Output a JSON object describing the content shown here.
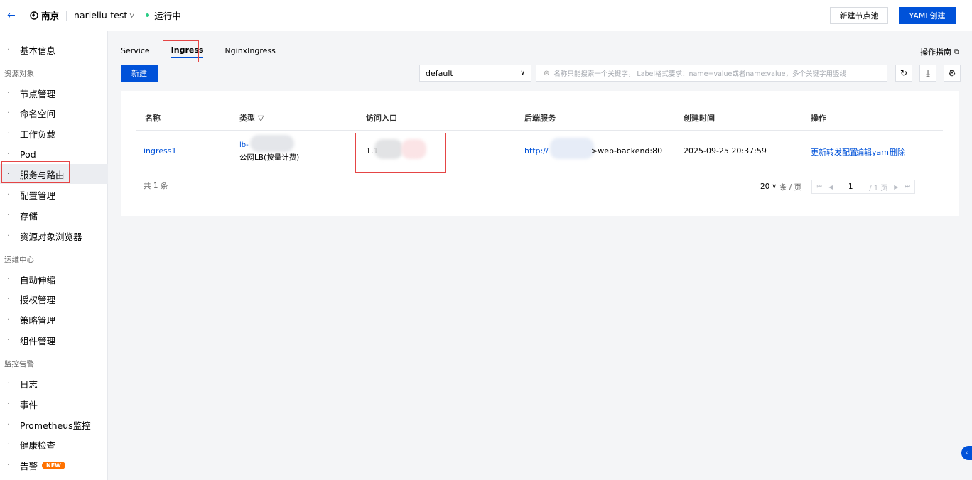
{
  "topbar": {
    "region": "南京",
    "cluster": "narieliu-test",
    "status": "运行中",
    "new_pool_button": "新建节点池",
    "yaml_button": "YAML创建"
  },
  "sidebar": {
    "items": [
      {
        "label": "基本信息"
      },
      {
        "group": "资源对象"
      },
      {
        "label": "节点管理"
      },
      {
        "label": "命名空间"
      },
      {
        "label": "工作负载"
      },
      {
        "label": "Pod"
      },
      {
        "label": "服务与路由"
      },
      {
        "label": "配置管理"
      },
      {
        "label": "存储"
      },
      {
        "label": "资源对象浏览器"
      },
      {
        "group": "运维中心"
      },
      {
        "label": "自动伸缩"
      },
      {
        "label": "授权管理"
      },
      {
        "label": "策略管理"
      },
      {
        "label": "组件管理"
      },
      {
        "group": "监控告警"
      },
      {
        "label": "日志"
      },
      {
        "label": "事件"
      },
      {
        "label": "Prometheus监控"
      },
      {
        "label": "健康检查"
      },
      {
        "label": "告警",
        "badge": "NEW"
      }
    ],
    "active": "服务与路由"
  },
  "tabs": [
    "Service",
    "Ingress",
    "NginxIngress"
  ],
  "active_tab": "Ingress",
  "guide_link": "操作指南",
  "toolbar": {
    "create_button": "新建",
    "namespace": "default",
    "search_placeholder": "名称只能搜索一个关键字， Label格式要求：name=value或者name:value，多个关键字用竖线"
  },
  "table": {
    "headers": [
      "名称",
      "类型",
      "访问入口",
      "后端服务",
      "创建时间",
      "操作"
    ],
    "rows": [
      {
        "name": "ingress1",
        "type_id": "lb-",
        "type_desc": "公网LB(按量计费)",
        "access": "1.1",
        "backend_prefix": "http://",
        "backend_suffix": ">web-backend:80",
        "created": "2025-09-25 20:37:59",
        "actions": [
          "更新转发配置",
          "编辑yaml",
          "删除"
        ]
      }
    ],
    "total": "共 1 条",
    "page_size": "20",
    "per_page_suffix": "条 / 页",
    "page": "1",
    "page_total": "/ 1 页"
  },
  "colors": {
    "accent": "#0052d9",
    "highlight_red": "#e54545",
    "status_green": "#29cc85",
    "new_badge": "#ff7200"
  }
}
